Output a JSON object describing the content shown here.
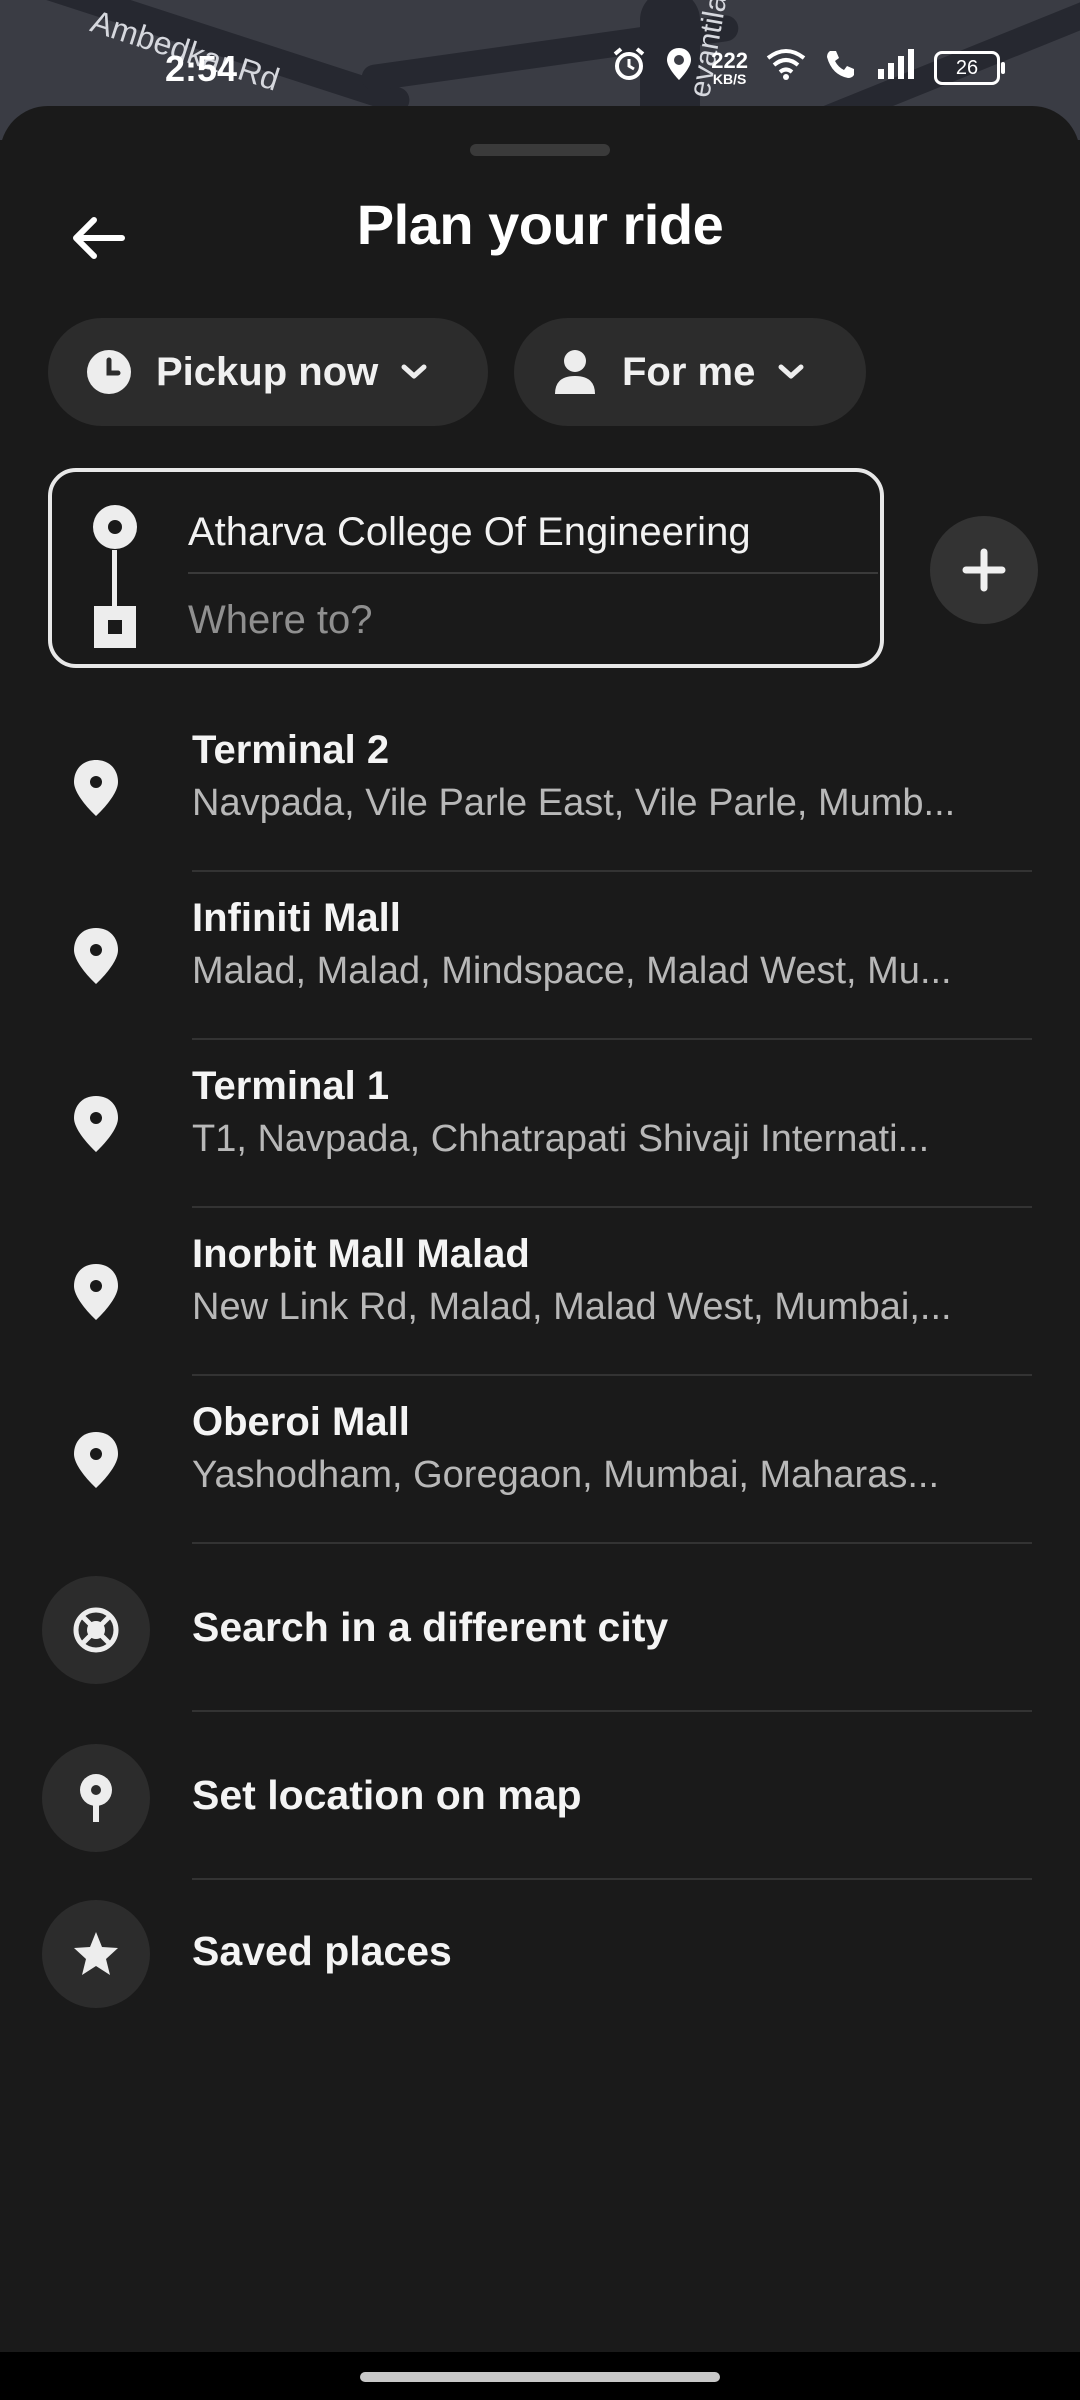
{
  "map": {
    "streets": [
      "Ambedkar Rd",
      "evantila"
    ]
  },
  "status_bar": {
    "time": "2:54",
    "net_speed": "222",
    "net_unit": "KB/S",
    "battery": "26",
    "icons": [
      "alarm-icon",
      "location-icon",
      "wifi-icon",
      "wifi-call-icon",
      "signal-icon",
      "battery-icon"
    ]
  },
  "header": {
    "title": "Plan your ride",
    "back_icon": "arrow-left-icon"
  },
  "chips": {
    "pickup_time": {
      "label": "Pickup now",
      "icon": "clock-icon"
    },
    "rider": {
      "label": "For me",
      "icon": "person-icon"
    }
  },
  "route": {
    "pickup_value": "Atharva College Of Engineering",
    "destination_placeholder": "Where to?",
    "destination_value": ""
  },
  "suggestions": [
    {
      "name": "Terminal 2",
      "address": "Navpada, Vile Parle East, Vile Parle, Mumb..."
    },
    {
      "name": "Infiniti Mall",
      "address": "Malad, Malad, Mindspace, Malad West, Mu..."
    },
    {
      "name": "Terminal 1",
      "address": "T1, Navpada, Chhatrapati Shivaji Internati..."
    },
    {
      "name": "Inorbit Mall Malad",
      "address": "New Link Rd, Malad, Malad West, Mumbai,..."
    },
    {
      "name": "Oberoi Mall",
      "address": "Yashodham, Goregaon, Mumbai, Maharas..."
    }
  ],
  "actions": [
    {
      "label": "Search in a different city",
      "icon": "globe-off-icon"
    },
    {
      "label": "Set location on map",
      "icon": "map-pin-icon"
    },
    {
      "label": "Saved places",
      "icon": "star-icon"
    }
  ],
  "colors": {
    "background": "#1a1a1a",
    "chip": "#2c2c2c",
    "text": "#ffffff",
    "muted": "#b8b8b8"
  }
}
